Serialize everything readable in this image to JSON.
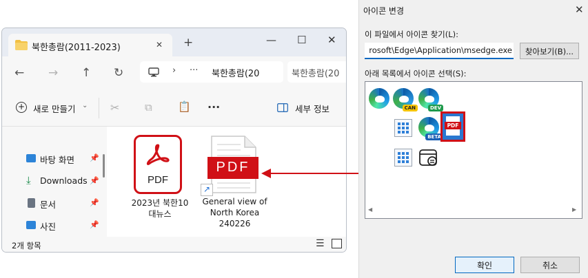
{
  "explorer": {
    "tab_title": "북한총람(2011-2023)",
    "new_tab": "+",
    "window_controls": {
      "minimize": "—",
      "maximize": "☐",
      "close": "✕"
    },
    "address": {
      "folder_label": "북한총람(20",
      "ellipsis": "···",
      "next_segment": "북한총람(20"
    },
    "toolbar": {
      "new_label": "새로 만들기",
      "more": "···",
      "details_label": "세부 정보"
    },
    "sidebar": [
      {
        "label": "바탕 화면",
        "color": "#2d84d8"
      },
      {
        "label": "Downloads",
        "color": "#1a8a4a"
      },
      {
        "label": "문서",
        "color": "#6a7482"
      },
      {
        "label": "사진",
        "color": "#2d84d8"
      }
    ],
    "files": [
      {
        "name_line1": "2023년 북한10",
        "name_line2": "대뉴스",
        "icon_text": "PDF"
      },
      {
        "name_line1": "General view of",
        "name_line2": "North Korea",
        "name_line3": "240226",
        "icon_text": "PDF"
      }
    ],
    "status_text": "2개 항목"
  },
  "dialog": {
    "title": "아이콘 변경",
    "close": "✕",
    "file_label": "이 파일에서 아이콘 찾기(L):",
    "file_path": "rosoft\\Edge\\Application\\msedge.exe",
    "browse_button": "찾아보기(B)...",
    "list_label": "아래 목록에서 아이콘 선택(S):",
    "badges": {
      "can": "CAN",
      "dev": "DEV",
      "beta": "BETA",
      "pdf": "PDF"
    },
    "ok_button": "확인",
    "cancel_button": "취소"
  },
  "colors": {
    "accent": "#0067c0",
    "pdf_red": "#d01016",
    "highlight_border": "#d01016"
  }
}
